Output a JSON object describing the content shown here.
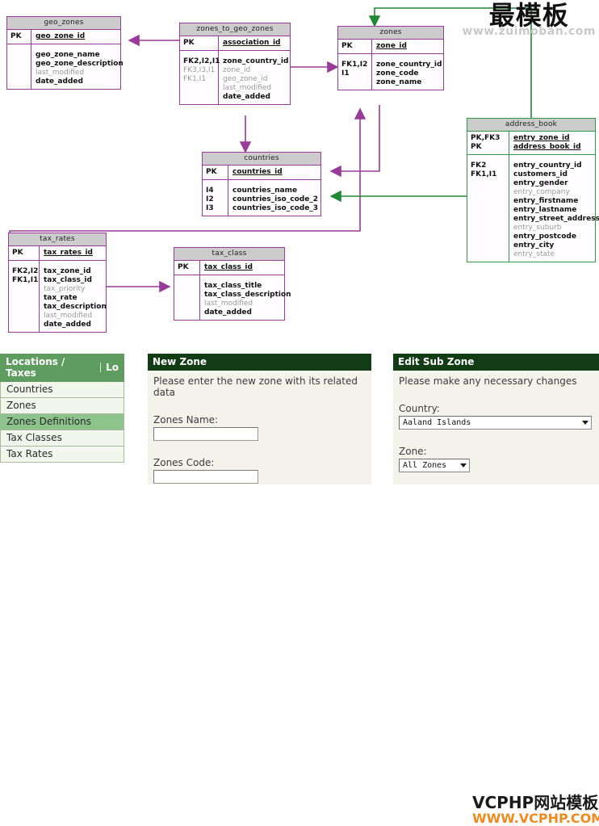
{
  "diagram": {
    "tables": [
      {
        "name": "geo_zones",
        "color": "#9a3a9a",
        "keys_left": [
          "PK"
        ],
        "keys_right": [
          "geo_zone_id"
        ],
        "attrs_left": [],
        "attrs_right": [
          "geo_zone_name",
          "geo_zone_description",
          "last_modified",
          "date_added"
        ]
      },
      {
        "name": "zones_to_geo_zones",
        "color": "#9a3a9a",
        "keys_left": [
          "PK"
        ],
        "keys_right": [
          "association_id"
        ],
        "attrs_left": [
          "FK2,I2,I1",
          "FK3,I3,I1",
          "FK1,I1"
        ],
        "attrs_right": [
          "zone_country_id",
          "zone_id",
          "geo_zone_id",
          "last_modified",
          "date_added"
        ]
      },
      {
        "name": "zones",
        "color": "#9a3a9a",
        "keys_left": [
          "PK"
        ],
        "keys_right": [
          "zone_id"
        ],
        "attrs_left": [
          "FK1,I2",
          "I1"
        ],
        "attrs_right": [
          "zone_country_id",
          "zone_code",
          "zone_name"
        ]
      },
      {
        "name": "address_book",
        "color": "#2f9b4a",
        "keys_left": [
          "PK,FK3",
          "PK"
        ],
        "keys_right": [
          "entry_zone_id",
          "address_book_id"
        ],
        "attrs_left": [
          "FK2",
          "FK1,I1"
        ],
        "attrs_right": [
          "entry_country_id",
          "customers_id",
          "entry_gender",
          "entry_company",
          "entry_firstname",
          "entry_lastname",
          "entry_street_address",
          "entry_suburb",
          "entry_postcode",
          "entry_city",
          "entry_state"
        ]
      },
      {
        "name": "countries",
        "color": "#9a3a9a",
        "keys_left": [
          "PK"
        ],
        "keys_right": [
          "countries_id"
        ],
        "attrs_left": [
          "I4",
          "I2",
          "I3"
        ],
        "attrs_right": [
          "countries_name",
          "countries_iso_code_2",
          "countries_iso_code_3"
        ]
      },
      {
        "name": "tax_rates",
        "color": "#9a3a9a",
        "keys_left": [
          "PK"
        ],
        "keys_right": [
          "tax_rates_id"
        ],
        "attrs_left": [
          "FK2,I2",
          "FK1,I1"
        ],
        "attrs_right": [
          "tax_zone_id",
          "tax_class_id",
          "tax_priority",
          "tax_rate",
          "tax_description",
          "last_modified",
          "date_added"
        ]
      },
      {
        "name": "tax_class",
        "color": "#9a3a9a",
        "keys_left": [
          "PK"
        ],
        "keys_right": [
          "tax_class_id"
        ],
        "attrs_left": [],
        "attrs_right": [
          "tax_class_title",
          "tax_class_description",
          "last_modified",
          "date_added"
        ]
      }
    ]
  },
  "watermark_top": {
    "cn": "最模板",
    "url": "www.zuimoban.com"
  },
  "watermark_bottom": {
    "cn": "VCPHP网站模板",
    "url": "WWW.VCPHP.COM"
  },
  "sidebar": {
    "header": "Locations / Taxes",
    "header_cut": "Lo",
    "items": [
      "Countries",
      "Zones",
      "Zones Definitions",
      "Tax Classes",
      "Tax Rates"
    ],
    "active_index": 2,
    "active_color": "#8cc48c"
  },
  "new_zone_panel": {
    "title": "New Zone",
    "instruction": "Please enter the new zone with its related data",
    "zones_name_label": "Zones Name:",
    "zones_name_value": "",
    "zones_code_label": "Zones Code:",
    "zones_code_value": ""
  },
  "edit_sub_zone_panel": {
    "title": "Edit Sub Zone",
    "instruction": "Please make any necessary changes",
    "country_label": "Country:",
    "country_value": "Aaland Islands",
    "zone_label": "Zone:",
    "zone_value": "All Zones"
  }
}
